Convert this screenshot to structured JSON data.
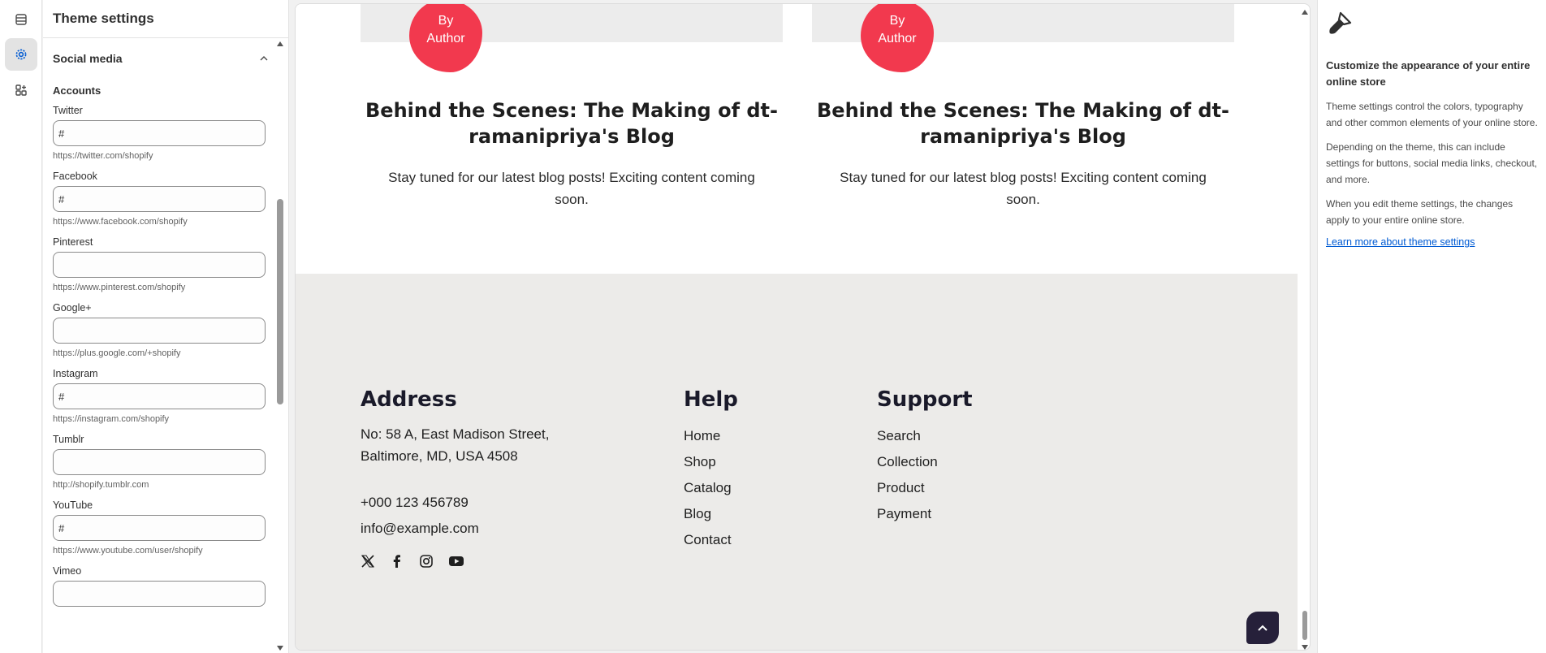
{
  "rail": {
    "items": [
      {
        "name": "sections",
        "active": false
      },
      {
        "name": "theme-settings",
        "active": true
      },
      {
        "name": "app-embeds",
        "active": false
      }
    ]
  },
  "panel": {
    "title": "Theme settings",
    "section_title": "Social media",
    "subsection_title": "Accounts",
    "fields": [
      {
        "label": "Twitter",
        "value": "#",
        "help": "https://twitter.com/shopify"
      },
      {
        "label": "Facebook",
        "value": "#",
        "help": "https://www.facebook.com/shopify"
      },
      {
        "label": "Pinterest",
        "value": "",
        "help": "https://www.pinterest.com/shopify"
      },
      {
        "label": "Google+",
        "value": "",
        "help": "https://plus.google.com/+shopify"
      },
      {
        "label": "Instagram",
        "value": "#",
        "help": "https://instagram.com/shopify"
      },
      {
        "label": "Tumblr",
        "value": "",
        "help": "http://shopify.tumblr.com"
      },
      {
        "label": "YouTube",
        "value": "#",
        "help": "https://www.youtube.com/user/shopify"
      },
      {
        "label": "Vimeo",
        "value": "",
        "help": ""
      }
    ]
  },
  "preview": {
    "cards": [
      {
        "badge_line1": "By",
        "badge_line2": "Author",
        "title": "Behind the Scenes: The Making of dt-ramanipriya's Blog",
        "text": "Stay tuned for our latest blog posts! Exciting content coming soon."
      },
      {
        "badge_line1": "By",
        "badge_line2": "Author",
        "title": "Behind the Scenes: The Making of dt-ramanipriya's Blog",
        "text": "Stay tuned for our latest blog posts! Exciting content coming soon."
      }
    ],
    "footer": {
      "address_heading": "Address",
      "address_line1": "No: 58 A, East Madison Street,",
      "address_line2": "Baltimore, MD, USA 4508",
      "phone": "+000 123 456789",
      "email": "info@example.com",
      "social_icons": [
        "x-icon",
        "facebook-icon",
        "instagram-icon",
        "youtube-icon"
      ],
      "help_heading": "Help",
      "help_links": [
        "Home",
        "Shop",
        "Catalog",
        "Blog",
        "Contact"
      ],
      "support_heading": "Support",
      "support_links": [
        "Search",
        "Collection",
        "Product",
        "Payment"
      ]
    },
    "colors": {
      "badge": "#f2394e",
      "footer_bg": "#ecebe9",
      "back_to_top": "#26203a"
    }
  },
  "info": {
    "title": "Customize the appearance of your entire online store",
    "paragraph1": "Theme settings control the colors, typography and other common elements of your online store.",
    "paragraph2": "Depending on the theme, this can include settings for buttons, social media links, checkout, and more.",
    "paragraph3": "When you edit theme settings, the changes apply to your entire online store.",
    "link": "Learn more about theme settings"
  }
}
